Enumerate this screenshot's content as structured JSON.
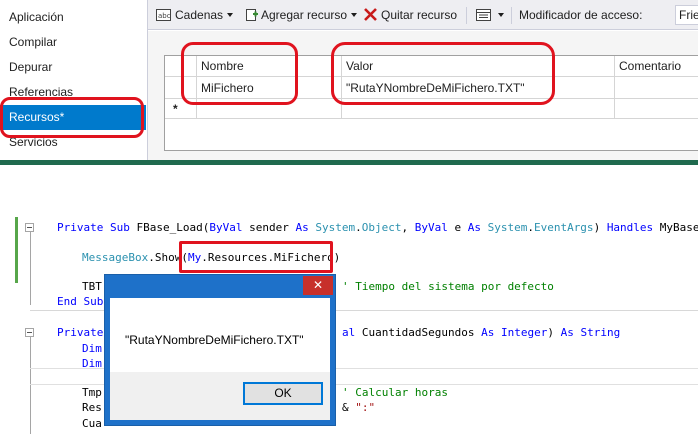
{
  "sidebar": {
    "items": [
      {
        "label": "Aplicación"
      },
      {
        "label": "Compilar"
      },
      {
        "label": "Depurar"
      },
      {
        "label": "Referencias"
      },
      {
        "label": "Recursos*"
      },
      {
        "label": "Servicios"
      }
    ],
    "selected": "Recursos*"
  },
  "toolbar": {
    "strings_label": "Cadenas",
    "add_resource_label": "Agregar recurso",
    "remove_resource_label": "Quitar recurso",
    "access_modifier_label": "Modificador de acceso:",
    "access_modifier_value": "Friend"
  },
  "grid": {
    "columns": [
      "Nombre",
      "Valor",
      "Comentario"
    ],
    "rows": [
      {
        "name": "MiFichero",
        "value": "\"RutaYNombreDeMiFichero.TXT\"",
        "comment": ""
      }
    ],
    "new_row_marker": "*"
  },
  "code": {
    "line1": {
      "t1": "Private Sub ",
      "t2": "FBase_Load(",
      "t3": "ByVal",
      "t4": " sender ",
      "t5": "As",
      "t6": " ",
      "t7": "System",
      "t8": ".",
      "t9": "Object",
      "t10": ", ",
      "t11": "ByVal",
      "t12": " e ",
      "t13": "As",
      "t14": " ",
      "t15": "System",
      "t16": ".",
      "t17": "EventArgs",
      "t18": ") ",
      "t19": "Handles",
      "t20": " MyBase.Lo"
    },
    "line2": {
      "t1": "MessageBox",
      "t2": ".Show(",
      "t3": "My",
      "t4": ".Resources.MiFichero)"
    },
    "line3": {
      "t1": "TBT",
      "t2": "' Tiempo del sistema por defecto"
    },
    "line4": {
      "t1": "End Sub"
    },
    "line5": {
      "t1": "Private",
      "t2": "al",
      "t3": " CuantidadSegundos ",
      "t4": "As",
      "t5": " ",
      "t6": "Integer",
      "t7": ") ",
      "t8": "As",
      "t9": " ",
      "t10": "String"
    },
    "line6": {
      "t1": "Dim"
    },
    "line7": {
      "t1": "Dim"
    },
    "line8": {
      "t1": "Tmp",
      "t2": "' Calcular horas"
    },
    "line9": {
      "t1": "Res",
      "t2": "& ",
      "t3": "\":\""
    },
    "line10": {
      "t1": "Cua"
    }
  },
  "messagebox": {
    "close_glyph": "✕",
    "text": "\"RutaYNombreDeMiFichero.TXT\"",
    "ok_label": "OK"
  },
  "colors": {
    "selection": "#007acc",
    "highlight_ring": "#e0131e",
    "keyword": "#0000ff",
    "type": "#2b91af",
    "comment": "#008000",
    "string": "#a31515",
    "dialog_frame": "#1e71c9",
    "dialog_close": "#c7302b"
  },
  "icons": {
    "strings": "strings-abc-icon",
    "add_resource": "add-resource-icon",
    "remove_resource": "red-x-icon",
    "view": "view-grid-icon"
  }
}
